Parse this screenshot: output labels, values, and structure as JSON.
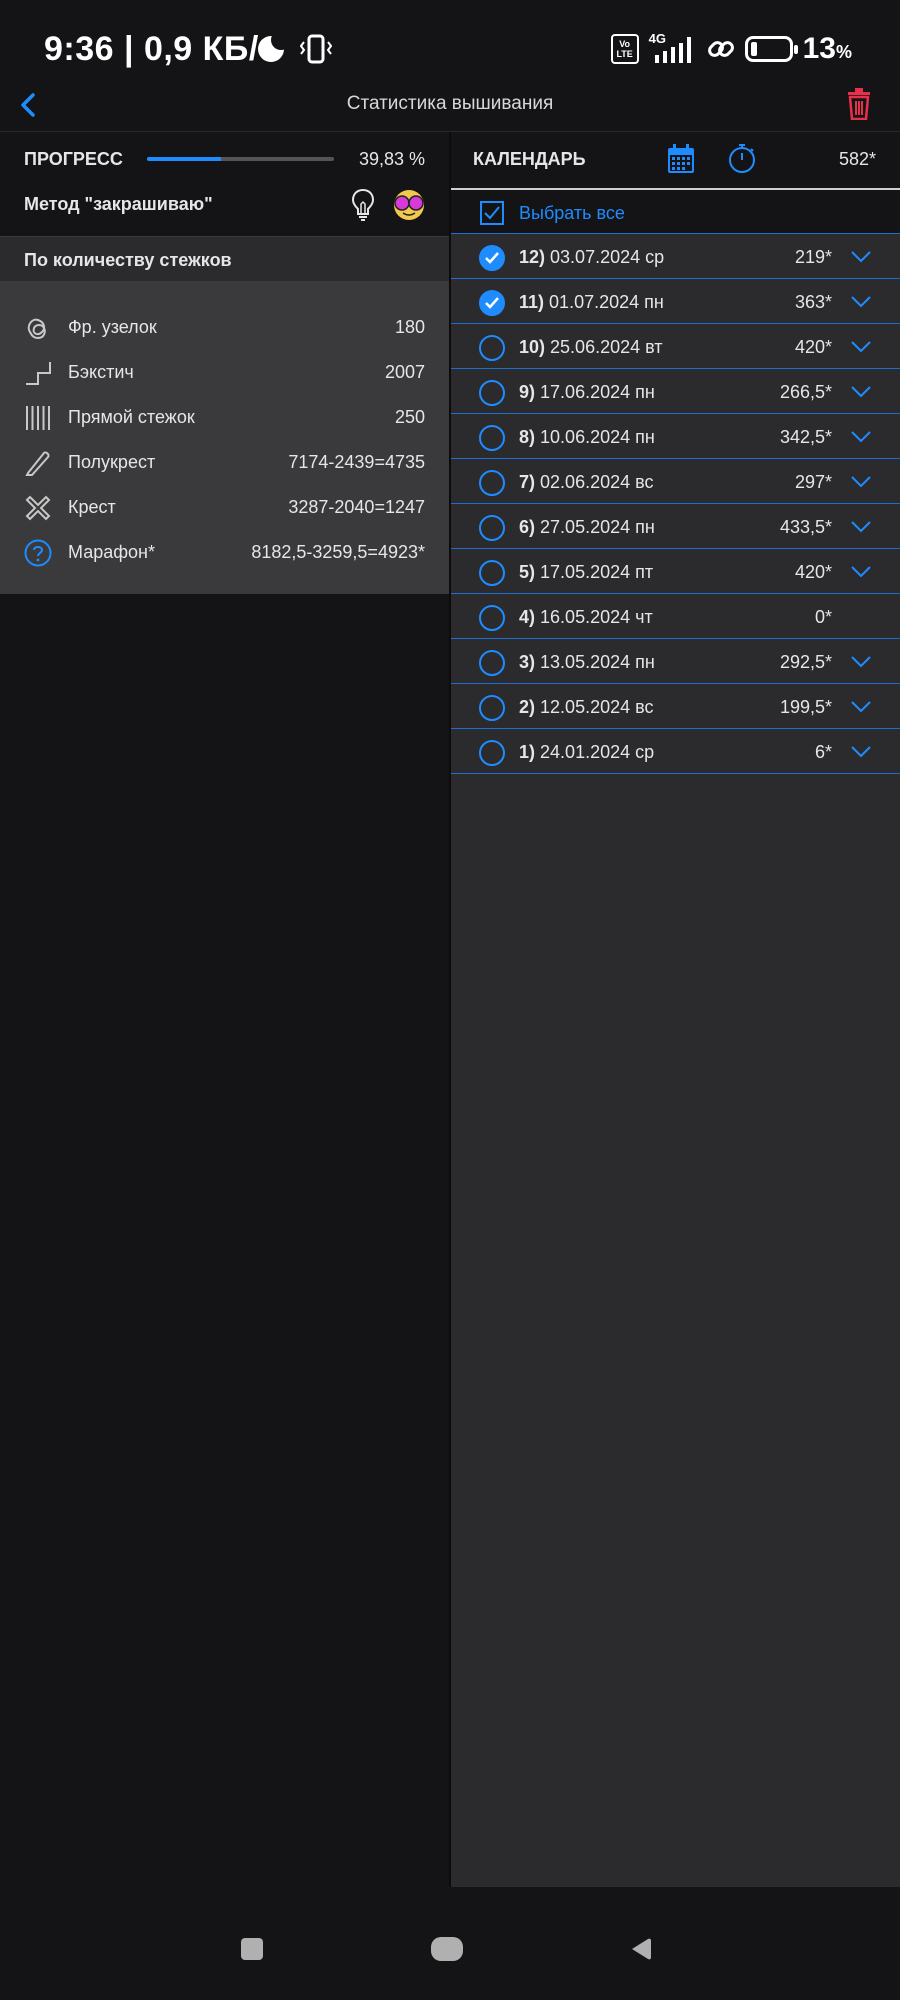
{
  "status": {
    "time": "9:36 | 0,9 КБ/с",
    "volte_top": "Vo",
    "volte_bottom": "LTE",
    "network": "4G",
    "battery_text": "13",
    "battery_unit": "%"
  },
  "header": {
    "title": "Статистика вышивания"
  },
  "progress": {
    "label": "ПРОГРЕСС",
    "value": "39,83 %",
    "fraction": 0.3983
  },
  "method": {
    "label": "Метод \"закрашиваю\""
  },
  "bycount": {
    "label": "По количеству стежков"
  },
  "stitches": [
    {
      "icon": "french-knot-icon",
      "name": "Фр. узелок",
      "value": "180"
    },
    {
      "icon": "backstitch-icon",
      "name": "Бэкстич",
      "value": "2007"
    },
    {
      "icon": "straight-stitch-icon",
      "name": "Прямой стежок",
      "value": "250"
    },
    {
      "icon": "half-cross-icon",
      "name": "Полукрест",
      "value": "7174-2439=4735"
    },
    {
      "icon": "cross-icon",
      "name": "Крест",
      "value": "3287-2040=1247"
    },
    {
      "icon": "question-icon",
      "name": "Марафон*",
      "value": "8182,5-3259,5=4923*"
    }
  ],
  "calendar": {
    "label": "КАЛЕНДАРЬ",
    "total": "582*",
    "select_all": "Выбрать все",
    "entries": [
      {
        "num": "12)",
        "date": "03.07.2024 ср",
        "value": "219*",
        "checked": true,
        "expandable": true
      },
      {
        "num": "11)",
        "date": "01.07.2024 пн",
        "value": "363*",
        "checked": true,
        "expandable": true
      },
      {
        "num": "10)",
        "date": "25.06.2024 вт",
        "value": "420*",
        "checked": false,
        "expandable": true
      },
      {
        "num": "9)",
        "date": "17.06.2024 пн",
        "value": "266,5*",
        "checked": false,
        "expandable": true
      },
      {
        "num": "8)",
        "date": "10.06.2024 пн",
        "value": "342,5*",
        "checked": false,
        "expandable": true
      },
      {
        "num": "7)",
        "date": "02.06.2024 вс",
        "value": "297*",
        "checked": false,
        "expandable": true
      },
      {
        "num": "6)",
        "date": "27.05.2024 пн",
        "value": "433,5*",
        "checked": false,
        "expandable": true
      },
      {
        "num": "5)",
        "date": "17.05.2024 пт",
        "value": "420*",
        "checked": false,
        "expandable": true
      },
      {
        "num": "4)",
        "date": "16.05.2024 чт",
        "value": "0*",
        "checked": false,
        "expandable": false
      },
      {
        "num": "3)",
        "date": "13.05.2024 пн",
        "value": "292,5*",
        "checked": false,
        "expandable": true
      },
      {
        "num": "2)",
        "date": "12.05.2024 вс",
        "value": "199,5*",
        "checked": false,
        "expandable": true
      },
      {
        "num": "1)",
        "date": "24.01.2024 ср",
        "value": "6*",
        "checked": false,
        "expandable": true
      }
    ]
  },
  "colors": {
    "accent": "#1e8cff",
    "danger": "#e8304a",
    "background": "#141416",
    "panel": "#2b2b2d",
    "stitch_panel": "#3a3a3c"
  }
}
